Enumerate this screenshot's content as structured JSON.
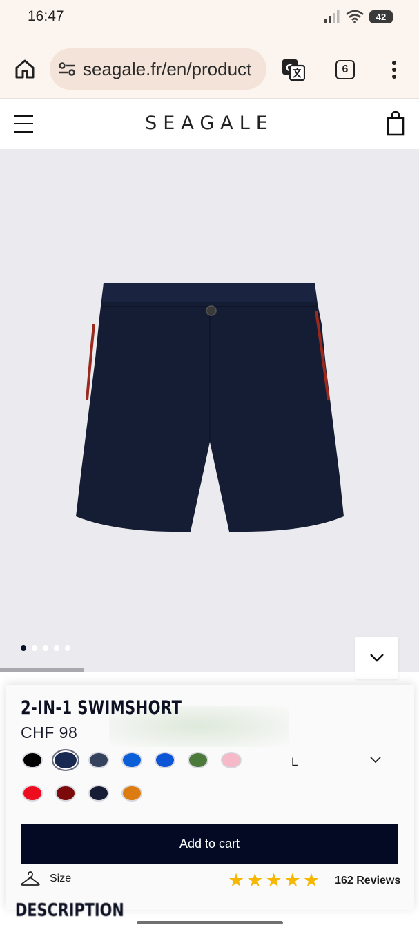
{
  "status_bar": {
    "time": "16:47",
    "battery": "42"
  },
  "browser": {
    "url": "seagale.fr/en/product",
    "tab_count": "6",
    "icons": [
      "home-icon",
      "site-settings-icon",
      "translate-icon",
      "tabs-icon",
      "more-vert-icon"
    ]
  },
  "site_header": {
    "logo": "SEAGALE",
    "icons": [
      "hamburger-menu-icon",
      "shopping-bag-icon"
    ]
  },
  "gallery": {
    "slide_count": 5,
    "active_slide": 1,
    "icons": [
      "chevron-down-icon"
    ]
  },
  "product": {
    "title": "2-IN-1 SWIMSHORT",
    "price": "CHF 98",
    "colors": [
      {
        "hex": "#000000",
        "selected": false
      },
      {
        "hex": "#182a52",
        "selected": true
      },
      {
        "hex": "#34425e",
        "selected": false
      },
      {
        "hex": "#0a5fd8",
        "selected": false
      },
      {
        "hex": "#0b55d6",
        "selected": false
      },
      {
        "hex": "#4c7a3a",
        "selected": false
      },
      {
        "hex": "#f6b9c8",
        "selected": false
      },
      {
        "hex": "#ee0d1e",
        "selected": false
      },
      {
        "hex": "#7d0a0a",
        "selected": false
      },
      {
        "hex": "#151c33",
        "selected": false
      },
      {
        "hex": "#db7b10",
        "selected": false
      }
    ],
    "size": "L",
    "add_to_cart_label": "Add to cart",
    "size_guide_label": "Size",
    "rating_stars": 5,
    "reviews_label": "162 Reviews",
    "section_heading_peek": "DESCRIPTION"
  },
  "colors": {
    "accent": "#040a24",
    "star": "#f5b700",
    "browser_bg": "#fcf4ef",
    "image_bg": "#ebebef"
  }
}
